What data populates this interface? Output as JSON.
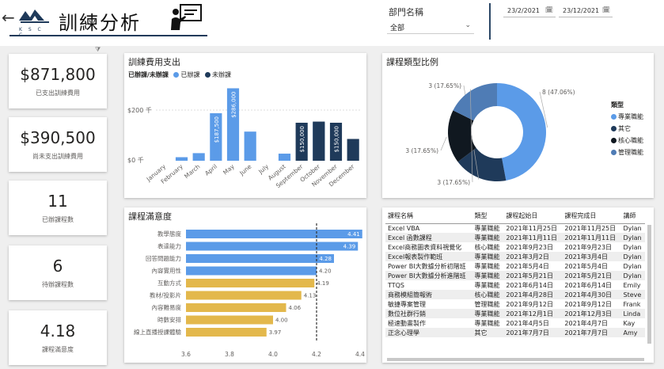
{
  "header": {
    "back_glyph": "←",
    "logo_text": "K S C C",
    "title": "訓練分析",
    "dept_filter": {
      "label": "部門名稱",
      "value": "全部"
    },
    "date_start": "23/2/2021",
    "date_end": "23/12/2021"
  },
  "kpis": [
    {
      "value": "$871,800",
      "label": "已支出訓練費用"
    },
    {
      "value": "$390,500",
      "label": "尚未支出訓練費用"
    },
    {
      "value": "11",
      "label": "已辦課程數"
    },
    {
      "value": "6",
      "label": "待辦課程數"
    },
    {
      "value": "4.18",
      "label": "課程滿意度"
    }
  ],
  "expense_panel": {
    "title": "訓練費用支出",
    "legend_title": "已辦課/未辦課",
    "legend": [
      {
        "label": "已辦課",
        "color": "#5b9be8"
      },
      {
        "label": "未辦課",
        "color": "#1f3a5a"
      }
    ]
  },
  "donut_panel": {
    "title": "課程類型比例",
    "legend_title": "類型"
  },
  "satisfaction_panel": {
    "title": "課程滿意度"
  },
  "table": {
    "columns": [
      "課程名稱",
      "類型",
      "課程起始日",
      "課程完成日",
      "講師"
    ],
    "rows": [
      [
        "Excel VBA",
        "專業職能",
        "2021年11月25日",
        "2021年11月25日",
        "Dylan"
      ],
      [
        "Excel 函數課程",
        "專業職能",
        "2021年11月11日",
        "2021年11月11日",
        "Dylan"
      ],
      [
        "Excel商務圖表資料視覺化",
        "核心職能",
        "2021年9月23日",
        "2021年9月23日",
        "Dylan"
      ],
      [
        "Excel報表製作範班",
        "專業職能",
        "2021年3月2日",
        "2021年3月4日",
        "Dylan"
      ],
      [
        "Power BI大數據分析初階班",
        "專業職能",
        "2021年5月4日",
        "2021年5月4日",
        "Dylan"
      ],
      [
        "Power BI大數據分析進階班",
        "專業職能",
        "2021年5月21日",
        "2021年5月21日",
        "Dylan"
      ],
      [
        "TTQS",
        "專業職能",
        "2021年6月14日",
        "2021年6月14日",
        "Emily"
      ],
      [
        "商務模組簡報術",
        "核心職能",
        "2021年4月28日",
        "2021年4月30日",
        "Steve"
      ],
      [
        "敏捷專案管理",
        "管理職能",
        "2021年9月12日",
        "2021年9月12日",
        "Frank"
      ],
      [
        "數位社群行銷",
        "專業職能",
        "2021年12月1日",
        "2021年12月3日",
        "Linda"
      ],
      [
        "極速動畫製作",
        "專業職能",
        "2021年4月5日",
        "2021年4月7日",
        "Kay"
      ],
      [
        "正念心理學",
        "其它",
        "2021年7月7日",
        "2021年7月7日",
        "Amy"
      ]
    ]
  },
  "chart_data": [
    {
      "type": "bar",
      "title": "訓練費用支出",
      "categories": [
        "January",
        "February",
        "March",
        "April",
        "May",
        "June",
        "July",
        "August",
        "September",
        "October",
        "November",
        "December"
      ],
      "series": [
        {
          "name": "已辦課",
          "color": "#5b9be8",
          "values": [
            0,
            14,
            30,
            187.5,
            286,
            115,
            0,
            28,
            0,
            150,
            0,
            0
          ]
        },
        {
          "name": "未辦課",
          "color": "#1f3a5a",
          "values": [
            0,
            0,
            0,
            0,
            0,
            0,
            0,
            0,
            150,
            154.5,
            150,
            86
          ]
        }
      ],
      "bar_labels": [
        "",
        "",
        "",
        "$187,500",
        "$286,000",
        "",
        "",
        "",
        "$150,000",
        "$154,500",
        "$150,000",
        ""
      ],
      "ytick_labels": [
        "$0 千",
        "$200 千"
      ],
      "ylim": [
        0,
        300
      ]
    },
    {
      "type": "pie",
      "title": "課程類型比例",
      "categories": [
        "專業職能",
        "其它",
        "核心職能",
        "管理職能"
      ],
      "values": [
        8,
        3,
        3,
        3
      ],
      "data_labels": [
        "8 (47.06%)",
        "3 (17.65%)",
        "3 (17.65%)",
        "3 (17.65%)"
      ],
      "colors": [
        "#5b9be8",
        "#1f3a5a",
        "#101820",
        "#4f7cb5"
      ]
    },
    {
      "type": "bar",
      "orientation": "horizontal",
      "title": "課程滿意度",
      "categories": [
        "教學態度",
        "表達能力",
        "回答問題能力",
        "內容實用性",
        "互動方式",
        "教材/投影片",
        "內容難易度",
        "時數安排",
        "線上直播授課體驗"
      ],
      "values": [
        4.41,
        4.39,
        4.28,
        4.2,
        4.19,
        4.13,
        4.06,
        4.0,
        3.97
      ],
      "colors": [
        "#5b9be8",
        "#5b9be8",
        "#5b9be8",
        "#5b9be8",
        "#e3b84c",
        "#e3b84c",
        "#e3b84c",
        "#e3b84c",
        "#e3b84c"
      ],
      "xtick_labels": [
        "3.6",
        "3.8",
        "4.0",
        "4.2",
        "4.4"
      ],
      "xlim": [
        3.6,
        4.4
      ],
      "reference_line": 4.2
    }
  ]
}
